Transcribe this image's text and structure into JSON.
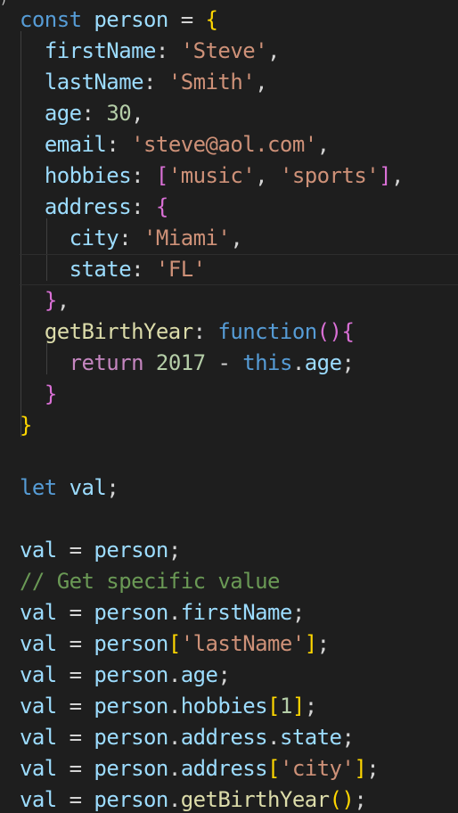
{
  "editor": {
    "language": "JavaScript",
    "theme_colors": {
      "background": "#1e1e1e",
      "keyword": "#569cd6",
      "property": "#9cdcfe",
      "string": "#ce9178",
      "number": "#b5cea8",
      "comment": "#6a9955",
      "function": "#dcdcaa",
      "bracket_level1": "#ffd700",
      "bracket_level2": "#da70d6",
      "bracket_level3": "#179fff"
    },
    "lines": [
      {
        "kw": "const",
        "name": "person",
        "op": "=",
        "brace": "{"
      },
      {
        "key": "firstName",
        "val": "'Steve'",
        "end": ","
      },
      {
        "key": "lastName",
        "val": "'Smith'",
        "end": ","
      },
      {
        "key": "age",
        "val": "30",
        "end": ","
      },
      {
        "key": "email",
        "val": "'steve@aol.com'",
        "end": ","
      },
      {
        "key": "hobbies",
        "open": "[",
        "s1": "'music'",
        "comma": ",",
        "s2": "'sports'",
        "close": "]",
        "end": ","
      },
      {
        "key": "address",
        "brace": "{"
      },
      {
        "key": "city",
        "val": "'Miami'",
        "end": ","
      },
      {
        "key": "state",
        "val": "'FL'"
      },
      {
        "brace": "}",
        "end": ","
      },
      {
        "key": "getBirthYear",
        "kw": "function",
        "paren_open": "(",
        "paren_close": ")",
        "brace": "{"
      },
      {
        "kw": "return",
        "num": "2017",
        "op": "-",
        "this": "this",
        "prop": "age",
        "end": ";"
      },
      {
        "brace": "}"
      },
      {
        "brace": "}"
      },
      {
        "kw": "let",
        "name": "val",
        "end": ";"
      },
      {
        "name": "val",
        "op": "=",
        "rhs": "person",
        "end": ";"
      },
      {
        "comment": "// Get specific value"
      },
      {
        "name": "val",
        "op": "=",
        "obj": "person",
        "dot": ".",
        "prop": "firstName",
        "end": ";"
      },
      {
        "name": "val",
        "op": "=",
        "obj": "person",
        "open": "[",
        "str": "'lastName'",
        "close": "]",
        "end": ";"
      },
      {
        "name": "val",
        "op": "=",
        "obj": "person",
        "dot": ".",
        "prop": "age",
        "end": ";"
      },
      {
        "name": "val",
        "op": "=",
        "obj": "person",
        "dot": ".",
        "prop": "hobbies",
        "open": "[",
        "num": "1",
        "close": "]",
        "end": ";"
      },
      {
        "name": "val",
        "op": "=",
        "obj": "person",
        "dot": ".",
        "prop": "address",
        "dot2": ".",
        "prop2": "state",
        "end": ";"
      },
      {
        "name": "val",
        "op": "=",
        "obj": "person",
        "dot": ".",
        "prop": "address",
        "open": "[",
        "str": "'city'",
        "close": "]",
        "end": ";"
      },
      {
        "name": "val",
        "op": "=",
        "obj": "person",
        "dot": ".",
        "fn": "getBirthYear",
        "paren": "()",
        "end": ";"
      }
    ]
  }
}
